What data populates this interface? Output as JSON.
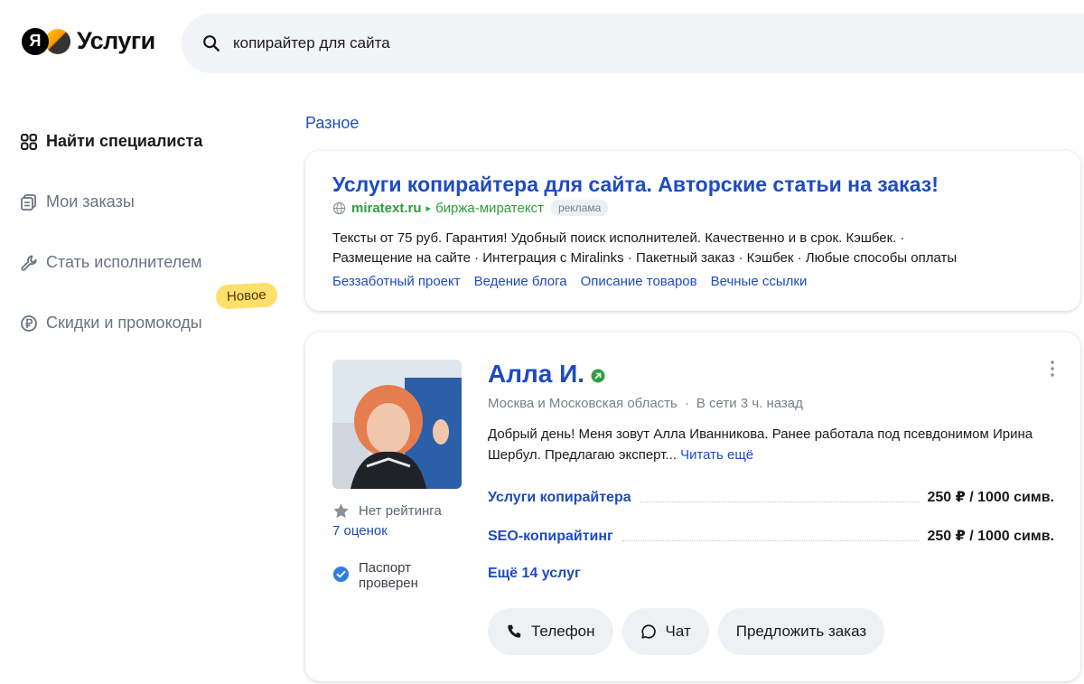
{
  "header": {
    "logo_letter": "Я",
    "logo_text": "Услуги",
    "search_value": "копирайтер для сайта"
  },
  "sidebar": {
    "items": [
      {
        "label": "Найти специалиста",
        "active": true,
        "icon": "grid-icon"
      },
      {
        "label": "Мои заказы",
        "active": false,
        "icon": "orders-icon"
      },
      {
        "label": "Стать исполнителем",
        "active": false,
        "icon": "wrench-icon"
      },
      {
        "label": "Скидки и промокоды",
        "active": false,
        "icon": "ruble-coin-icon"
      }
    ],
    "new_badge": "Новое"
  },
  "main": {
    "section_title": "Разное",
    "ad": {
      "title": "Услуги копирайтера для сайта. Авторские статьи на заказ!",
      "domain": "miratext.ru",
      "path": "биржа-миратекст",
      "label": "реклама",
      "text_line1": "Тексты от 75 руб. Гарантия! Удобный поиск исполнителей. Качественно и в срок. Кэшбек.  ·",
      "text_line2": "Размещение на сайте  ·  Интеграция с Miralinks  ·  Пакетный заказ  ·  Кэшбек  ·  Любые способы оплаты",
      "links": [
        "Беззаботный проект",
        "Ведение блога",
        "Описание товаров",
        "Вечные ссылки"
      ]
    },
    "specialist": {
      "name": "Алла И.",
      "location": "Москва и Московская область",
      "online_status": "В сети 3 ч. назад",
      "about": "Добрый день! Меня зовут Алла Иванникова. Ранее работала под псевдонимом Ирина Шербул. Предлагаю эксперт...",
      "read_more": "Читать ещё",
      "rating": "Нет рейтинга",
      "reviews": "7 оценок",
      "passport_line1": "Паспорт",
      "passport_line2": "проверен",
      "services": [
        {
          "name": "Услуги копирайтера",
          "price": "250 ₽ / 1000 симв."
        },
        {
          "name": "SEO-копирайтинг",
          "price": "250 ₽ / 1000 симв."
        }
      ],
      "more_services": "Ещё 14 услуг",
      "actions": {
        "phone": "Телефон",
        "chat": "Чат",
        "offer": "Предложить заказ"
      }
    }
  }
}
